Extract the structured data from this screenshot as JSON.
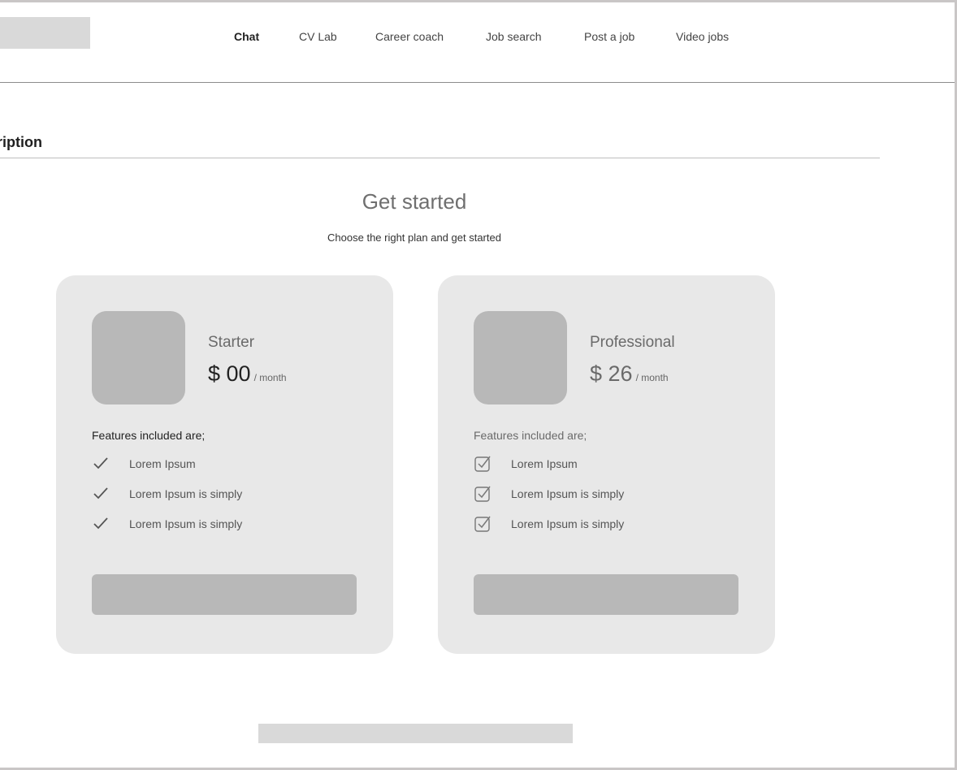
{
  "nav": {
    "items": [
      {
        "label": "Chat",
        "active": true
      },
      {
        "label": "CV Lab",
        "active": false
      },
      {
        "label": "Career coach",
        "active": false
      },
      {
        "label": "Job search",
        "active": false
      },
      {
        "label": "Post a job",
        "active": false
      },
      {
        "label": "Video jobs",
        "active": false
      }
    ]
  },
  "page": {
    "section_title": "ription"
  },
  "hero": {
    "title": "Get started",
    "subtitle": "Choose the right plan and get started"
  },
  "plans": [
    {
      "name": "Starter",
      "price": "$ 00",
      "period": "/ month",
      "features_heading": "Features included are;",
      "features": [
        "Lorem Ipsum",
        "Lorem Ipsum is simply",
        "Lorem Ipsum is simply"
      ],
      "feature_icon": "check-icon"
    },
    {
      "name": "Professional",
      "price": "$ 26",
      "period": "/ month",
      "features_heading": "Features included are;",
      "features": [
        "Lorem Ipsum",
        "Lorem Ipsum is simply",
        "Lorem Ipsum is simply"
      ],
      "feature_icon": "checkbox-checked-icon"
    }
  ],
  "colors": {
    "card_bg": "#e8e8e8",
    "placeholder": "#b8b8b8",
    "header_divider": "#8c8c8c"
  }
}
